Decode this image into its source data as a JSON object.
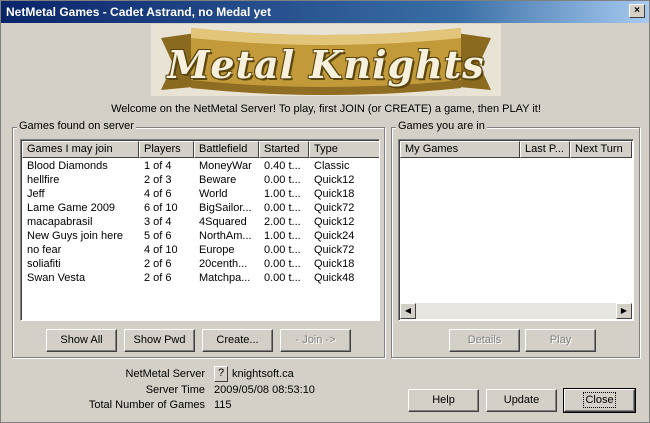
{
  "window": {
    "title": "NetMetal Games - Cadet Astrand, no Medal yet",
    "close_glyph": "×"
  },
  "banner": {
    "text": "Metal Knights"
  },
  "welcome": "Welcome on the NetMetal Server! To play, first JOIN (or CREATE) a game, then PLAY it!",
  "games_found": {
    "group_label": "Games found on server",
    "columns": [
      "Games I may join",
      "Players",
      "Battlefield",
      "Started",
      "Type"
    ],
    "rows": [
      [
        "Blood Diamonds",
        "1 of 4",
        "MoneyWar",
        "0.40 t...",
        "Classic"
      ],
      [
        "hellfire",
        "2 of 3",
        "Beware",
        "0.00 t...",
        "Quick12"
      ],
      [
        "Jeff",
        "4 of 6",
        "World",
        "1.00 t...",
        "Quick18"
      ],
      [
        "Lame Game 2009",
        "6 of 10",
        "BigSailor...",
        "0.00 t...",
        "Quick72"
      ],
      [
        "macapabrasil",
        "3 of 4",
        "4Squared",
        "2.00 t...",
        "Quick12"
      ],
      [
        "New Guys join here",
        "5 of 6",
        "NorthAm...",
        "1.00 t...",
        "Quick24"
      ],
      [
        "no fear",
        "4 of 10",
        "Europe",
        "0.00 t...",
        "Quick72"
      ],
      [
        "soliafiti",
        "2 of 6",
        "20centh...",
        "0.00 t...",
        "Quick18"
      ],
      [
        "Swan Vesta",
        "2 of 6",
        "Matchpa...",
        "0.00 t...",
        "Quick48"
      ]
    ],
    "buttons": {
      "show_all": "Show All",
      "show_pwd": "Show Pwd",
      "create": "Create...",
      "join": "- Join ->"
    }
  },
  "games_in": {
    "group_label": "Games you are in",
    "columns": [
      "My Games",
      "Last P...",
      "Next Turn"
    ],
    "scroll_left": "◀",
    "scroll_right": "▶",
    "buttons": {
      "details": "Details",
      "play": "Play"
    }
  },
  "server_info": {
    "server_label": "NetMetal Server",
    "server_help": "?",
    "server_value": "knightsoft.ca",
    "time_label": "Server Time",
    "time_value": "2009/05/08 08:53:10",
    "total_label": "Total Number of Games",
    "total_value": "115"
  },
  "footer_buttons": {
    "help": "Help",
    "update": "Update",
    "close": "Close"
  }
}
